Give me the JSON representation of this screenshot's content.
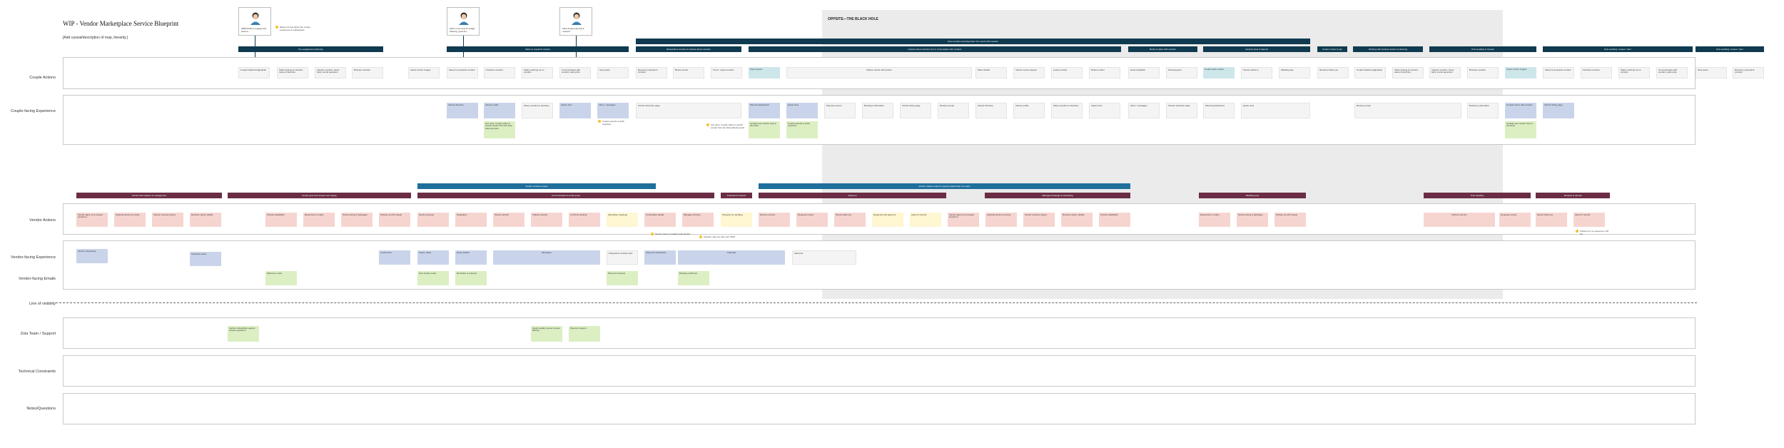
{
  "title": "WIP - Vendor Marketplace Service Blueprint",
  "subtitle": "[Add caveat/description of map, linearity.]",
  "opportunity_label": "OPPSITE—THE BLACK HOLE",
  "lanes": [
    "Couple Actions",
    "Couple-facing Experience",
    "Vendor Actions",
    "Vendor-facing Experience",
    "Vendor-facing Emails",
    "Line of visibility",
    "Zola Team / Support",
    "Technical Constraints",
    "Notes/Questions"
  ],
  "personas": [
    {
      "caption": "[PERSONA] is engaged and starts to..."
    },
    {
      "caption": "Starts to use Zola for budget. Planning, guest list..."
    },
    {
      "caption": "Starts budget planning & research..."
    }
  ],
  "persona_note": "Wants to know about the vendor experience & marketplace",
  "couple_phases": [
    "Pre-engagement planning",
    "Starts to research vendors",
    "Researches vendors & inquires about vendors",
    "Inquires about vendors & is in conversation with vendors",
    "Books & plans with vendors",
    "Vendors book & deposit",
    "Vendor review & pay",
    "Working with booked vendors & planning",
    "Post wedding & reviews",
    "Post wedding / review / refer"
  ],
  "couple_super_phase": "Hires vendors and pays them & in touch with vendors",
  "couple_actions": [
    "Couple finalize budget/plan",
    "Starts looking at vendors, saves & favorites",
    "Inquires vendors, hears back, sends questions",
    "Browses vendors",
    "Views vendor images",
    "Saves & compares vendors",
    "Favorites vendors",
    "Starts reaching out to vendors",
    "Communicates with vendors, asks price",
    "Gets quote",
    "Receives proposal & contract",
    "Books vendor",
    "Tours / meets vendors",
    "Pays deposit",
    "Shares vendor with partner",
    "Plans details",
    "Vendor review request",
    "Leaves review",
    "Refers vendor",
    "Gives feedback",
    "Final payment",
    "Couple rates vendor",
    "Vendor check-in",
    "Wedding day",
    "Receives thank you"
  ],
  "couple_experience": [
    "Vendor directory",
    "Vendor profile",
    "Saves vendors to favorites",
    "Inquiry form",
    "Inbox / messages",
    "Vendor storefront page",
    "Planning dashboard",
    "Quote view",
    "Payment screen",
    "Booking confirmation",
    "Vendor listing page",
    "Review prompt",
    "Couples inbox with vendors"
  ],
  "couple_notes": [
    "Use case: Couple starts to search vendor from the Zola planning tools",
    "Couple expects a quick response",
    "Couples see vendor reply in the inbox"
  ],
  "vendor_phases": [
    "Vendor lead capture & management",
    "Vendor gets and reviews new inquiry",
    "Communicates & sends quote",
    "Proposal & contract",
    "Payment",
    "Manages bookings & scheduling",
    "Wedding prep",
    "Wedding day",
    "Post wedding",
    "Reviews & referral"
  ],
  "vendor_super_phases": [
    "Vendor receives inquiry",
    "Vendor makes a sale & ongoing relationship w/ couple"
  ],
  "vendor_actions": [
    "Vendor signs up & creates storefront",
    "Uploads photos & pricing",
    "Vendor receives inquiry",
    "Reviews inquiry details",
    "Checks availability",
    "Responds to couple",
    "Sends pricing & packages",
    "Follows up with couple",
    "Sends proposal",
    "Negotiates",
    "Sends contract",
    "Collects deposit",
    "Confirms booking",
    "Schedules meetings",
    "Coordinates details",
    "Manages timeline",
    "Prepares for wedding",
    "Delivers service",
    "Requests review",
    "Sends thank you",
    "Requests final payment",
    "Asks for referral"
  ],
  "vendor_experience": [
    "Vendor onboarding",
    "Storefront editor",
    "Leads inbox",
    "Inquiry detail",
    "Quote builder",
    "Messages",
    "Proposal & contract tools",
    "Payments dashboard",
    "Calendar",
    "Client list"
  ],
  "vendor_emails": [
    "Welcome email",
    "New inquiry email",
    "Reminder to respond",
    "Payment received",
    "Booking confirmed",
    "Review request"
  ],
  "vendor_notes": [
    "Vendor wants to qualify leads quickly",
    "Vendors may use their own CRM",
    "Follow up if no response in 48 hrs"
  ],
  "zola_support": [
    "Vendor onboarding support, answer questions",
    "Inquiry quality review & spam filtering",
    "Payment support"
  ]
}
